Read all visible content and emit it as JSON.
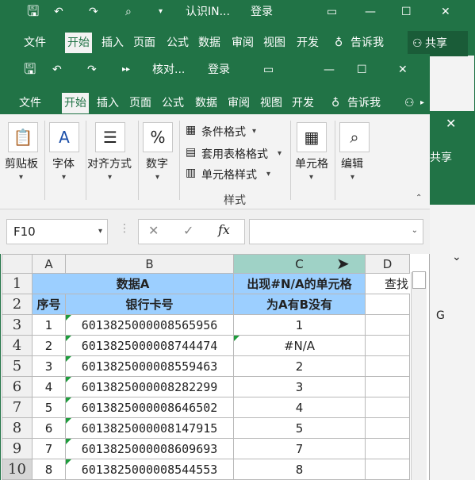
{
  "bg_window": {
    "title": "认识IN...",
    "account": "登录",
    "tabs": [
      "文件",
      "开始",
      "插入",
      "页面",
      "公式",
      "数据",
      "审阅",
      "视图",
      "开发",
      "告诉我"
    ],
    "share": "共享",
    "partial_share": "共享",
    "partial_col": "G",
    "close": "✕"
  },
  "fg_window": {
    "title": "核对...",
    "account": "登录",
    "tabs": [
      "文件",
      "开始",
      "插入",
      "页面",
      "公式",
      "数据",
      "审阅",
      "视图",
      "开发",
      "告诉我"
    ]
  },
  "ribbon": {
    "clipboard": "剪贴板",
    "font": "字体",
    "alignment": "对齐方式",
    "number": "数字",
    "conditional_format": "条件格式",
    "table_format": "套用表格格式",
    "cell_style": "单元格样式",
    "styles_group": "样式",
    "cells": "单元格",
    "editing": "编辑"
  },
  "formula_bar": {
    "name_box": "F10",
    "formula": ""
  },
  "grid": {
    "columns": [
      "A",
      "B",
      "C",
      "D"
    ],
    "header_row1": {
      "ab": "数据A",
      "c": "出现#N/A的单元格",
      "d": "查找"
    },
    "header_row2": {
      "a": "序号",
      "b": "银行卡号",
      "c": "为A有B没有"
    },
    "rows": [
      {
        "row": "3",
        "a": "1",
        "b": "6013825000008565956",
        "c": "1"
      },
      {
        "row": "4",
        "a": "2",
        "b": "6013825000008744474",
        "c": "#N/A"
      },
      {
        "row": "5",
        "a": "3",
        "b": "6013825000008559463",
        "c": "2"
      },
      {
        "row": "6",
        "a": "4",
        "b": "6013825000008282299",
        "c": "3"
      },
      {
        "row": "7",
        "a": "5",
        "b": "6013825000008646502",
        "c": "4"
      },
      {
        "row": "8",
        "a": "6",
        "b": "6013825000008147915",
        "c": "5"
      },
      {
        "row": "9",
        "a": "7",
        "b": "6013825000008609693",
        "c": "7"
      },
      {
        "row": "10",
        "a": "8",
        "b": "6013825000008544553",
        "c": "8"
      }
    ]
  }
}
